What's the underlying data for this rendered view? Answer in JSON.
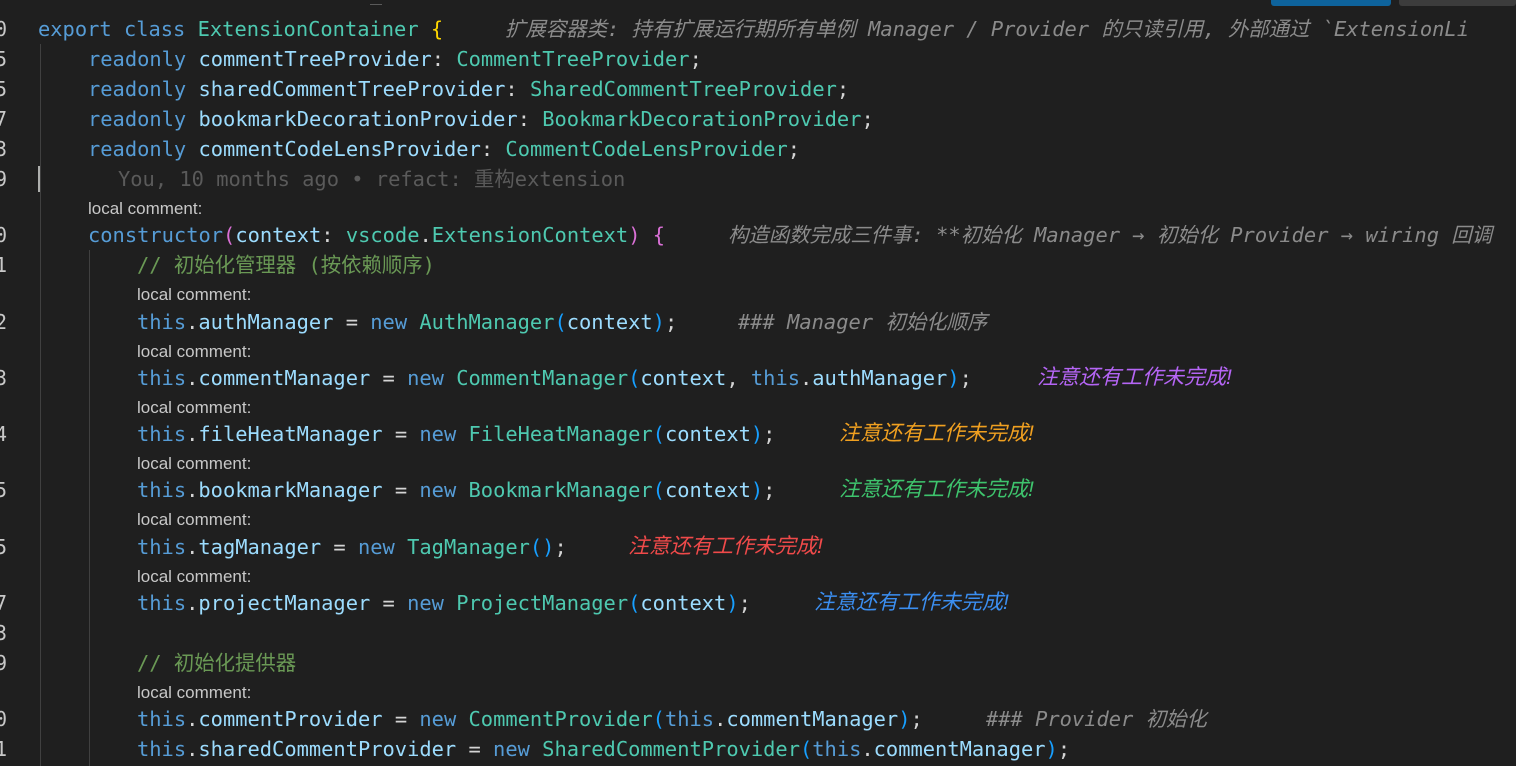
{
  "line_numbers": [
    "0",
    "5",
    "5",
    "7",
    "3",
    "9",
    "0",
    "1",
    "2",
    "3",
    "4",
    "5",
    "5",
    "7",
    "3",
    "9",
    "0",
    "1"
  ],
  "local_comment_label": "local comment:",
  "header": {
    "export": "export",
    "class": "class",
    "class_name": "ExtensionContainer",
    "brace": "{",
    "hint": "扩展容器类: 持有扩展运行期所有单例 Manager / Provider 的只读引用, 外部通过 `ExtensionLi"
  },
  "readonly_lines": [
    {
      "kw": "readonly",
      "name": "commentTreeProvider",
      "type": "CommentTreeProvider"
    },
    {
      "kw": "readonly",
      "name": "sharedCommentTreeProvider",
      "type": "SharedCommentTreeProvider"
    },
    {
      "kw": "readonly",
      "name": "bookmarkDecorationProvider",
      "type": "BookmarkDecorationProvider"
    },
    {
      "kw": "readonly",
      "name": "commentCodeLensProvider",
      "type": "CommentCodeLensProvider"
    }
  ],
  "blame": "You, 10 months ago • refact: 重构extension",
  "constructor": {
    "kw": "constructor",
    "param": "context",
    "ns": "vscode",
    "type": "ExtensionContext",
    "hint": "构造函数完成三件事: **初始化 Manager → 初始化 Provider → wiring 回调"
  },
  "comment_managers": "// 初始化管理器 (按依赖顺序)",
  "comment_providers": "// 初始化提供器",
  "this_kw": "this",
  "new_kw": "new",
  "managers": [
    {
      "prop": "authManager",
      "cls": "AuthManager",
      "args": "context",
      "note": "### Manager 初始化顺序",
      "note_color": "#8b8b8b"
    },
    {
      "prop": "commentManager",
      "cls": "CommentManager",
      "args": "context, this.authManager",
      "note": "注意还有工作未完成!",
      "note_color": "#b565f5"
    },
    {
      "prop": "fileHeatManager",
      "cls": "FileHeatManager",
      "args": "context",
      "note": "注意还有工作未完成!",
      "note_color": "#f0a020"
    },
    {
      "prop": "bookmarkManager",
      "cls": "BookmarkManager",
      "args": "context",
      "note": "注意还有工作未完成!",
      "note_color": "#3ec46d"
    },
    {
      "prop": "tagManager",
      "cls": "TagManager",
      "args": "",
      "note": "注意还有工作未完成!",
      "note_color": "#f04a4a"
    },
    {
      "prop": "projectManager",
      "cls": "ProjectManager",
      "args": "context",
      "note": "注意还有工作未完成!",
      "note_color": "#3b8ef0"
    }
  ],
  "providers": [
    {
      "prop": "commentProvider",
      "cls": "CommentProvider",
      "args": "this.commentManager",
      "note": "### Provider 初始化"
    },
    {
      "prop": "sharedCommentProvider",
      "cls": "SharedCommentProvider",
      "args": "this.commentManager",
      "note": ""
    }
  ],
  "colors": {
    "background": "#1f1f1f",
    "keyword": "#569cd6",
    "type": "#4ec9b0",
    "property": "#9cdcfe",
    "comment": "#6a9955",
    "bracket_gold": "#ffd700",
    "bracket_purple": "#da70d6",
    "bracket_blue": "#179fff"
  }
}
